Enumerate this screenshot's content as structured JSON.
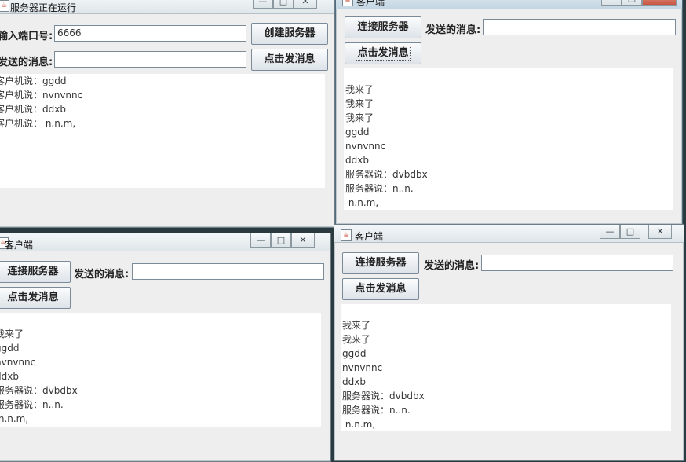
{
  "server": {
    "title": "服务器正在运行",
    "port_label": "输入端口号:",
    "port_value": "6666",
    "create_button": "创建服务器",
    "send_label": "发送的消息:",
    "send_value": "",
    "send_button": "点击发消息",
    "messages": [
      "客户机说：ggdd",
      "客户机说：nvnvnnc",
      "客户机说：ddxb",
      "客户机说： n.n.m,"
    ]
  },
  "client_top_right": {
    "title": "客户端",
    "connect_button": "连接服务器",
    "send_label": "发送的消息:",
    "send_value": "",
    "send_button": "点击发消息",
    "messages": [
      "我来了",
      "我来了",
      "我来了",
      "ggdd",
      "nvnvnnc",
      "ddxb",
      "服务器说：dvbdbx",
      "服务器说：n..n.",
      " n.n.m,"
    ]
  },
  "client_bottom_left": {
    "title": "客户端",
    "connect_button": "连接服务器",
    "send_label": "发送的消息:",
    "send_value": "",
    "send_button": "点击发消息",
    "messages": [
      "我来了",
      "ggdd",
      "nvnvnnc",
      "ddxb",
      "服务器说：dvbdbx",
      "服务器说：n..n.",
      " n.n.m,"
    ]
  },
  "client_bottom_right": {
    "title": "客户端",
    "connect_button": "连接服务器",
    "send_label": "发送的消息:",
    "send_value": "",
    "send_button": "点击发消息",
    "messages": [
      "我来了",
      "我来了",
      "ggdd",
      "nvnvnnc",
      "ddxb",
      "服务器说：dvbdbx",
      "服务器说：n..n.",
      " n.n.m,"
    ]
  },
  "window_controls": {
    "minimize": "—",
    "maximize": "□",
    "close": "✕"
  },
  "colors": {
    "desktop": "#2b3a3e",
    "window_bg": "#eeeeee",
    "close_active": "#c75642"
  }
}
